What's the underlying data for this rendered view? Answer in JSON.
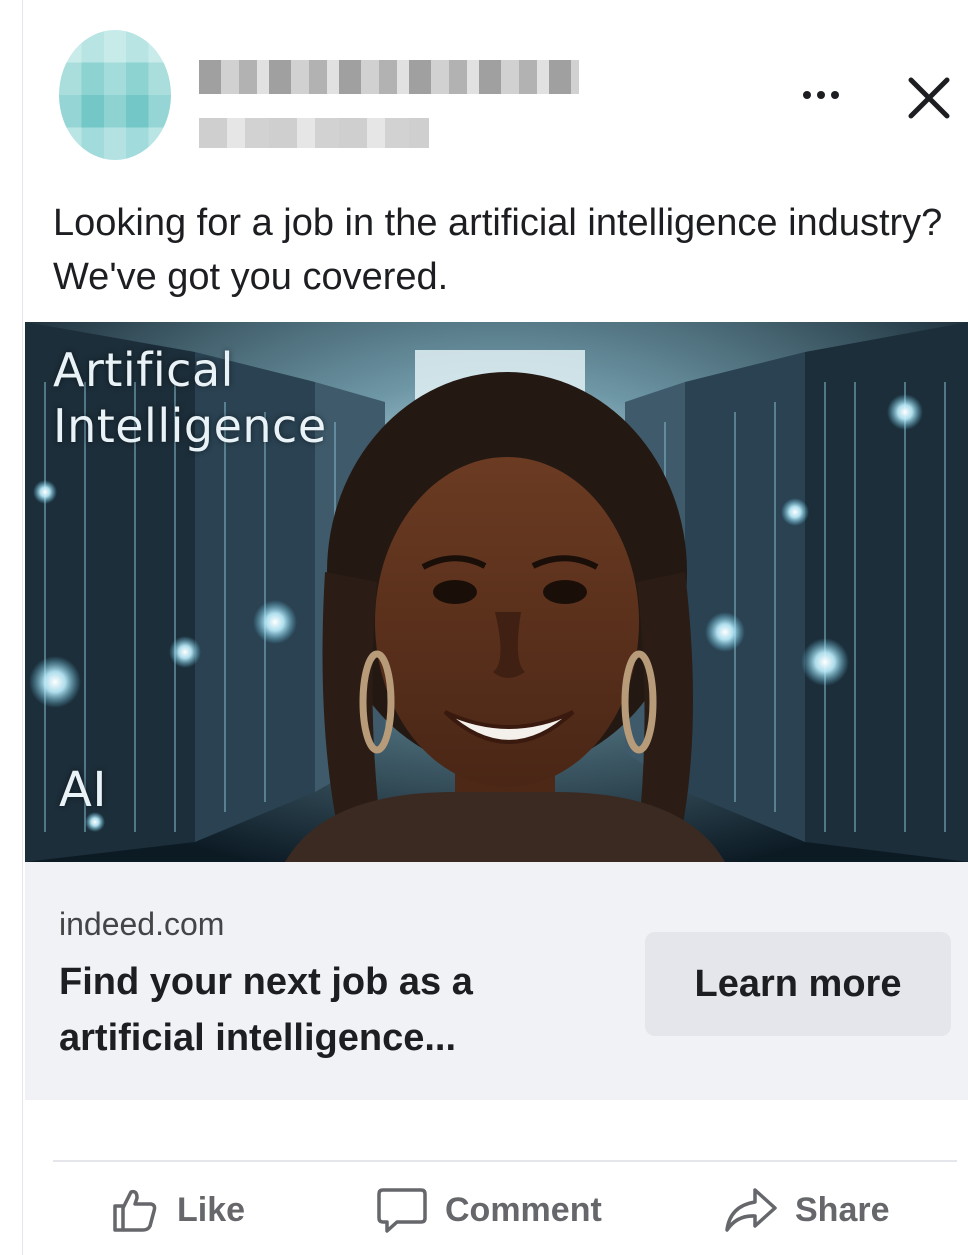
{
  "post": {
    "author_name": "",
    "caption": "Looking for a job in the artificial intelligence industry? We've got you covered."
  },
  "image": {
    "overlay_title": "Artifical Intelligence",
    "overlay_tag": "AI"
  },
  "link_preview": {
    "domain": "indeed.com",
    "headline": "Find your next job as a artificial intelligence...",
    "cta_label": "Learn more"
  },
  "actions": {
    "like": "Like",
    "comment": "Comment",
    "share": "Share"
  },
  "colors": {
    "text_primary": "#1c1e21",
    "text_secondary": "#65676b",
    "preview_bg": "#f0f2f5",
    "button_bg": "#e4e6eb"
  },
  "icons": [
    "more-icon",
    "close-icon",
    "like-icon",
    "comment-icon",
    "share-icon"
  ]
}
